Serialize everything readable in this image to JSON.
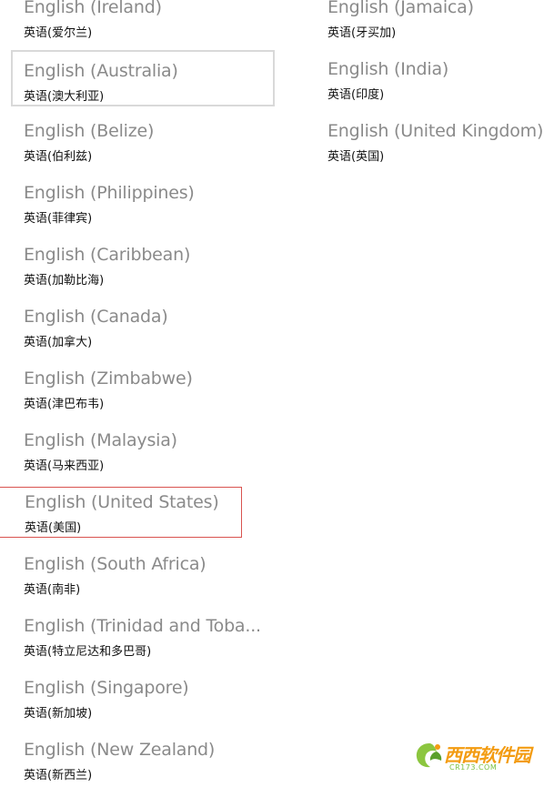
{
  "left_column": [
    {
      "name": "English (Ireland)",
      "native": "英语(爱尔兰)"
    },
    {
      "name": "English (Australia)",
      "native": "英语(澳大利亚)"
    },
    {
      "name": "English (Belize)",
      "native": "英语(伯利兹)"
    },
    {
      "name": "English (Philippines)",
      "native": "英语(菲律宾)"
    },
    {
      "name": "English (Caribbean)",
      "native": "英语(加勒比海)"
    },
    {
      "name": "English (Canada)",
      "native": "英语(加拿大)"
    },
    {
      "name": "English (Zimbabwe)",
      "native": "英语(津巴布韦)"
    },
    {
      "name": "English (Malaysia)",
      "native": "英语(马来西亚)"
    },
    {
      "name": "English (United States)",
      "native": "英语(美国)"
    },
    {
      "name": "English (South Africa)",
      "native": "英语(南非)"
    },
    {
      "name": "English (Trinidad and Toba...",
      "native": "英语(特立尼达和多巴哥)"
    },
    {
      "name": "English (Singapore)",
      "native": "英语(新加坡)"
    },
    {
      "name": "English (New Zealand)",
      "native": "英语(新西兰)"
    }
  ],
  "right_column": [
    {
      "name": "English (Jamaica)",
      "native": "英语(牙买加)"
    },
    {
      "name": "English (India)",
      "native": "英语(印度)"
    },
    {
      "name": "English (United Kingdom)",
      "native": "英语(英国)"
    }
  ],
  "watermark": {
    "text": "西西软件园",
    "url": "CR173.COM"
  }
}
